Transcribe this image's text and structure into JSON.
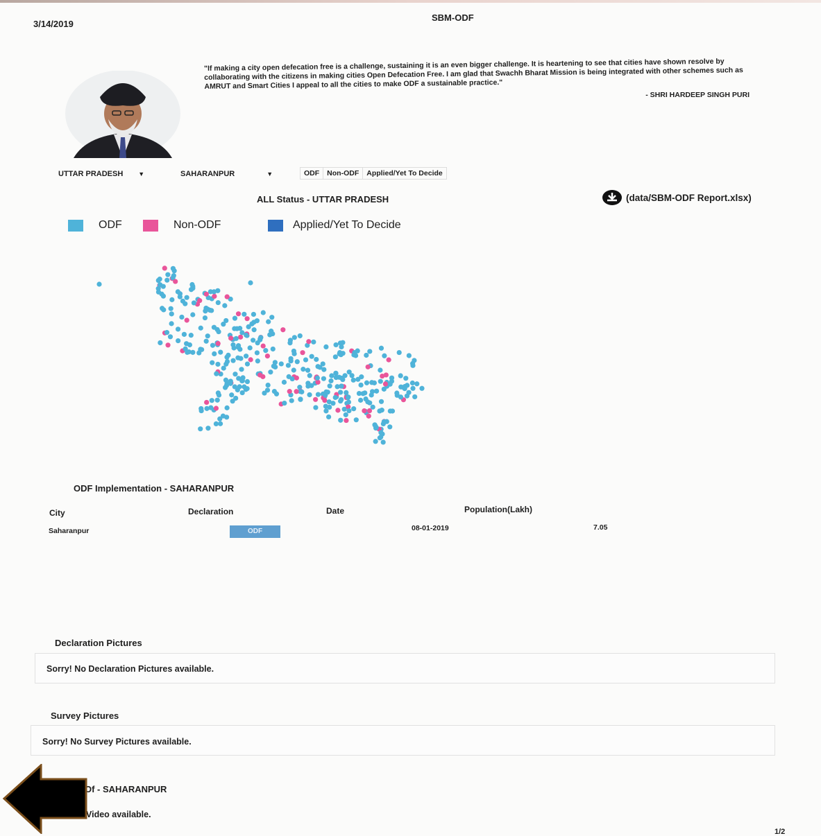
{
  "header": {
    "date": "3/14/2019",
    "title": "SBM-ODF"
  },
  "quote": {
    "text": "\"If making a city open defecation free is a challenge, sustaining it is an even bigger challenge. It is heartening to see that cities have shown resolve by collaborating with the citizens in making cities Open Defecation Free. I am glad that Swachh Bharat Mission is being integrated with other schemes such as AMRUT and Smart Cities I appeal to all the cities to make ODF a sustainable practice.\"",
    "author": "- SHRI HARDEEP SINGH PURI"
  },
  "selects": {
    "state": "UTTAR PRADESH",
    "city": "SAHARANPUR"
  },
  "filters": [
    "ODF",
    "Non-ODF",
    "Applied/Yet To Decide"
  ],
  "status_title": "ALL Status - UTTAR PRADESH",
  "download": {
    "label": "(data/SBM-ODF Report.xlsx)",
    "icon": "download-icon"
  },
  "legend": [
    {
      "label": "ODF",
      "color": "#4fb3d9"
    },
    {
      "label": "Non-ODF",
      "color": "#e9559a"
    },
    {
      "label": "Applied/Yet To Decide",
      "color": "#2f6fbf"
    }
  ],
  "implementation": {
    "title": "ODF Implementation - SAHARANPUR",
    "columns": [
      "City",
      "Declaration",
      "Date",
      "Population(Lakh)"
    ],
    "row": {
      "city": "Saharanpur",
      "declaration": "ODF",
      "date": "08-01-2019",
      "population": "7.05"
    }
  },
  "declaration_pictures": {
    "title": "Declaration Pictures",
    "message": "Sorry! No Declaration Pictures available."
  },
  "survey_pictures": {
    "title": "Survey Pictures",
    "message": "Sorry! No Survey Pictures available."
  },
  "video": {
    "title": "Of - SAHARANPUR",
    "message": "Video available."
  },
  "page_number": "1/2"
}
